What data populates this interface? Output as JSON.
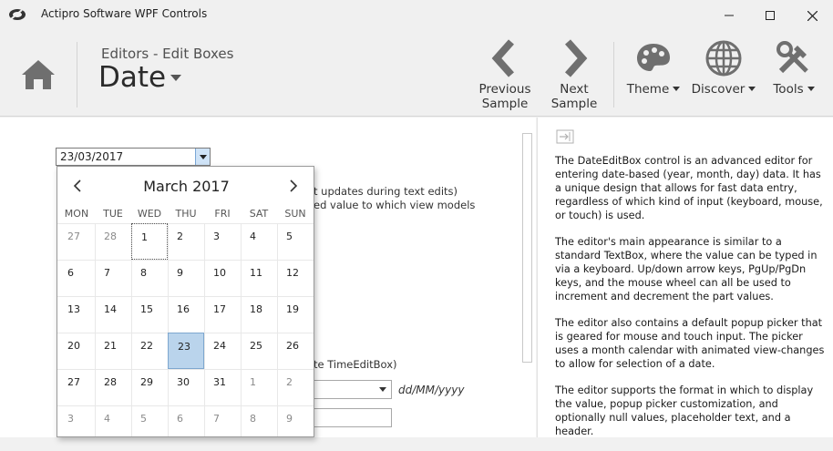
{
  "window": {
    "title": "Actipro Software WPF Controls",
    "logo_icon": "actipro-logo-icon",
    "controls": [
      "minimize-icon",
      "maximize-icon",
      "close-icon"
    ]
  },
  "ribbon": {
    "breadcrumb": "Editors - Edit Boxes",
    "title": "Date",
    "buttons": {
      "previous": {
        "label1": "Previous",
        "label2": "Sample",
        "icon": "chevron-left-icon"
      },
      "next": {
        "label1": "Next",
        "label2": "Sample",
        "icon": "chevron-right-icon"
      },
      "theme": {
        "label": "Theme",
        "icon": "palette-icon"
      },
      "discover": {
        "label": "Discover",
        "icon": "globe-icon"
      },
      "tools": {
        "label": "Tools",
        "icon": "tools-icon"
      }
    },
    "accent": "#6f6f6f"
  },
  "editor": {
    "value": "23/03/2017",
    "format": "dd/MM/yyyy",
    "partial_texts": {
      "line1": "t updates during text edits)",
      "line2": "ed value to which view models",
      "line3": "te TimeEditBox)"
    }
  },
  "calendar": {
    "month_year": "March 2017",
    "weekdays": [
      "MON",
      "TUE",
      "WED",
      "THU",
      "FRI",
      "SAT",
      "SUN"
    ],
    "weeks": [
      [
        "27",
        "28",
        "1",
        "2",
        "3",
        "4",
        "5"
      ],
      [
        "6",
        "7",
        "8",
        "9",
        "10",
        "11",
        "12"
      ],
      [
        "13",
        "14",
        "15",
        "16",
        "17",
        "18",
        "19"
      ],
      [
        "20",
        "21",
        "22",
        "23",
        "24",
        "25",
        "26"
      ],
      [
        "27",
        "28",
        "29",
        "30",
        "31",
        "1",
        "2"
      ],
      [
        "3",
        "4",
        "5",
        "6",
        "7",
        "8",
        "9"
      ]
    ],
    "selected_color": "#bad4ec"
  },
  "panel": {
    "icon": "collapse-panel-icon",
    "paragraphs": [
      "The DateEditBox control is an advanced editor for entering date-based (year, month, day) data. It has a unique design that allows for fast data entry, regardless of which kind of input (keyboard, mouse, or touch) is used.",
      "The editor's main appearance is similar to a standard TextBox, where the value can be typed in via a keyboard. Up/down arrow keys, PgUp/PgDn keys, and the mouse wheel can all be used to increment and decrement the part values.",
      "The editor also contains a default popup picker that is geared for mouse and touch input. The picker uses a month calendar with animated view-changes to allow for selection of a date.",
      "The editor supports the format in which to display the value, popup picker customization, and optionally null values, placeholder text, and a header."
    ]
  }
}
